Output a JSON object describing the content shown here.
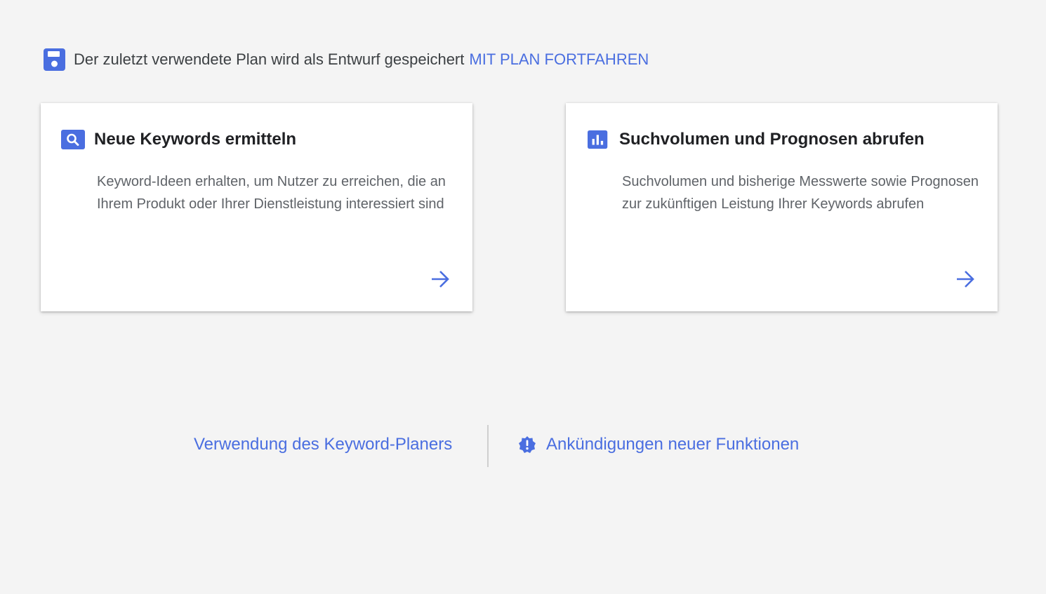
{
  "banner": {
    "icon": "save-icon",
    "text": "Der zuletzt verwendete Plan wird als Entwurf gespeichert",
    "link": "MIT PLAN FORTFAHREN"
  },
  "cards": [
    {
      "icon": "search-icon",
      "title": "Neue Keywords ermitteln",
      "description": "Keyword-Ideen erhalten, um Nutzer zu erreichen, die an Ihrem Produkt oder Ihrer Dienstleistung interessiert sind",
      "arrow_icon": "arrow-right-icon"
    },
    {
      "icon": "bar-chart-icon",
      "title": "Suchvolumen und Prognosen abrufen",
      "description": "Suchvolumen und bisherige Messwerte sowie Prognosen zur zukünftigen Leistung Ihrer Keywords abrufen",
      "arrow_icon": "arrow-right-icon"
    }
  ],
  "footer": {
    "help_link": "Verwendung des Keyword-Planers",
    "announcements_icon": "announcement-badge-icon",
    "announcements_link": "Ankündigungen neuer Funktionen"
  },
  "colors": {
    "accent": "#4a6ee0",
    "background": "#f4f4f4",
    "card": "#ffffff"
  }
}
